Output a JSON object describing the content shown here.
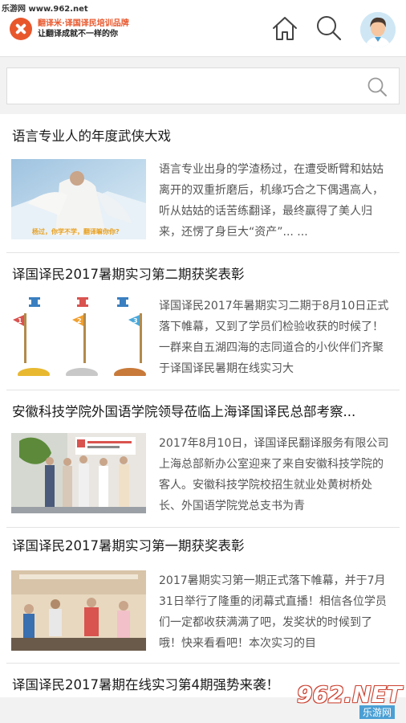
{
  "watermark_top": "乐游网 www.962.net",
  "header": {
    "logo_title": "翻译米·译国译民培训品牌",
    "logo_slogan": "让翻译成就不一样的你",
    "home_icon": "home-icon",
    "search_icon": "search-icon",
    "avatar_icon": "user-avatar-icon"
  },
  "search": {
    "value": "",
    "icon": "search-icon"
  },
  "articles": [
    {
      "title": "语言专业人的年度武侠大戏",
      "excerpt": "语言专业出身的学渣杨过，在遭受断臂和姑姑离开的双重折磨后，机缘巧合之下偶遇高人，听从姑姑的话苦练翻译，最终赢得了美人归来，还愣了身巨大“资产”... ...",
      "thumb_caption": "杨过，你学不学，翻译嘛你你?"
    },
    {
      "title": "译国译民2017暑期实习第二期获奖表彰",
      "excerpt": "译国译民2017年暑期实习二期于8月10日正式落下帷幕，又到了学员们检验收获的时候了！一群来自五湖四海的志同道合的小伙伴们齐聚于译国译民暑期在线实习大",
      "flag_numbers": [
        "1",
        "2",
        "3"
      ]
    },
    {
      "title": "安徽科技学院外国语学院领导莅临上海译国译民总部考察...",
      "excerpt": "2017年8月10日，译国译民翻译服务有限公司上海总部新办公室迎来了来自安徽科技学院的客人。安徽科技学院校招生就业处黄树桥处长、外国语学院党总支书为青"
    },
    {
      "title": "译国译民2017暑期实习第一期获奖表彰",
      "excerpt": "2017暑期实习第一期正式落下帷幕，并于7月31日举行了隆重的闭幕式直播！相信各位学员们一定都收获满满了吧，发奖状的时候到了哦！快来看看吧！本次实习的目"
    },
    {
      "title": "译国译民2017暑期在线实习第4期强势来袭！"
    }
  ],
  "watermark_bottom": {
    "brand": "962.NET",
    "sub": "乐游网"
  },
  "colors": {
    "brand": "#e8572c",
    "accent_blue": "#4a9fd4"
  }
}
